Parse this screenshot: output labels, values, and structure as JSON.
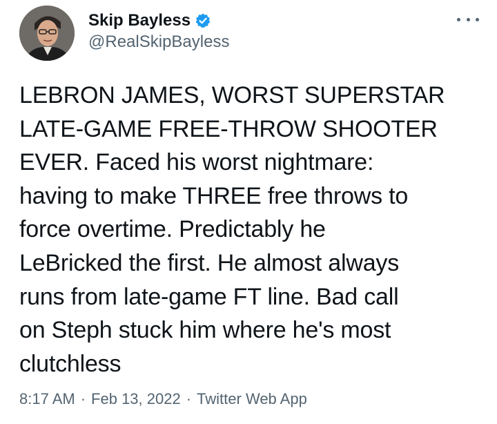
{
  "user": {
    "display_name": "Skip Bayless",
    "handle": "@RealSkipBayless",
    "verified": true,
    "verified_color": "#1d9bf0"
  },
  "tweet": {
    "text": "LEBRON JAMES, WORST SUPERSTAR\nLATE-GAME FREE-THROW SHOOTER\nEVER. Faced his worst nightmare:\nhaving to make THREE free throws to\nforce overtime. Predictably he\nLeBricked the first. He almost always\nruns from late-game FT line. Bad call\non Steph stuck him where he's most\nclutchless",
    "time": "8:17 AM",
    "date": "Feb 13, 2022",
    "source": "Twitter Web App",
    "separator": "·"
  },
  "icons": {
    "more": "more-options-icon",
    "verified": "verified-badge-icon"
  },
  "colors": {
    "text_primary": "#0f1419",
    "text_secondary": "#536471"
  }
}
